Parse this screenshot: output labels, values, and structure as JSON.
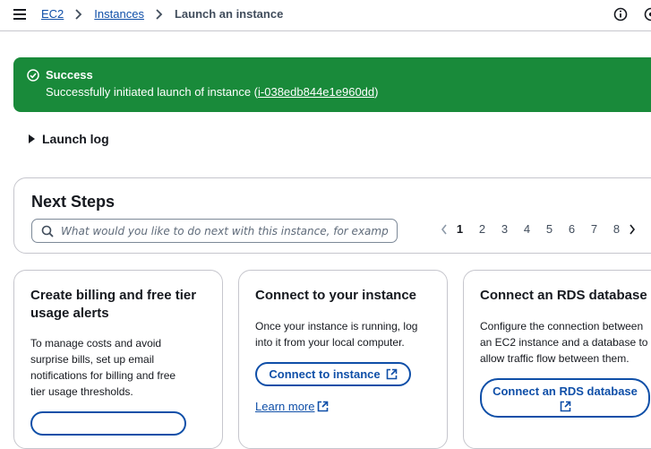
{
  "breadcrumb": {
    "items": [
      {
        "label": "EC2"
      },
      {
        "label": "Instances"
      },
      {
        "label": "Launch an instance"
      }
    ]
  },
  "flash": {
    "title": "Success",
    "message_prefix": "Successfully initiated launch of instance (",
    "instance_id": "i-038edb844e1e960dd",
    "message_suffix": ")",
    "color": "#198a3a"
  },
  "launch_log": {
    "label": "Launch log"
  },
  "next_steps": {
    "title": "Next Steps",
    "search_placeholder": "What would you like to do next with this instance, for example “cr",
    "pages": [
      "1",
      "2",
      "3",
      "4",
      "5",
      "6",
      "7",
      "8"
    ],
    "current_page": "1"
  },
  "cards": [
    {
      "title": "Create billing and free tier usage alerts",
      "description_lines": [
        "To manage costs and avoid",
        "surprise bills, set up email",
        "notifications for billing and free",
        "tier usage thresholds."
      ]
    },
    {
      "title": "Connect to your instance",
      "description_lines": [
        "Once your instance is running, log",
        "into it from your local computer."
      ],
      "button_label": "Connect to instance",
      "learn_more_label": "Learn more"
    },
    {
      "title": "Connect an RDS database",
      "description_lines": [
        "Configure the connection between",
        "an EC2 instance and a database to",
        "allow traffic flow between them."
      ],
      "button_label": "Connect an RDS database"
    }
  ],
  "colors": {
    "link": "#0f4fa8",
    "success": "#198a3a",
    "text": "#16191f"
  }
}
